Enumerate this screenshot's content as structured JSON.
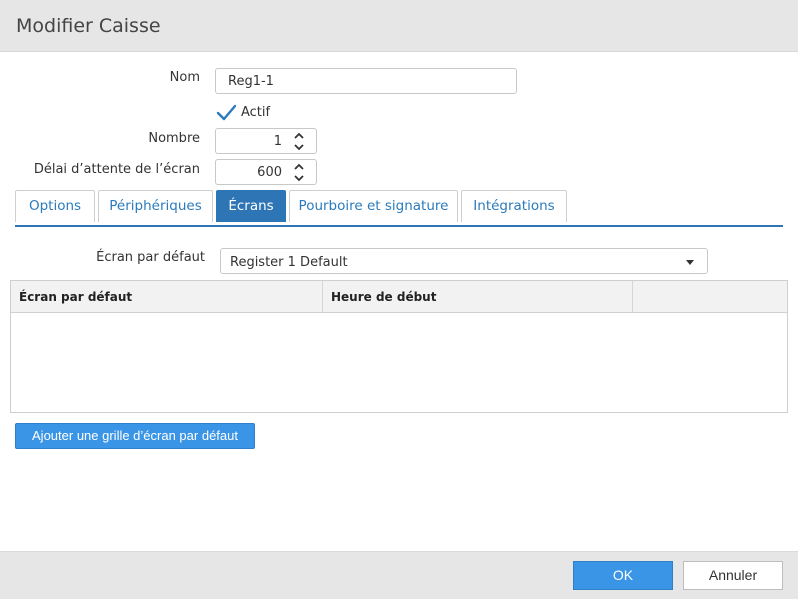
{
  "dialog": {
    "title": "Modifier Caisse"
  },
  "form": {
    "name_label": "Nom",
    "name_value": "Reg1-1",
    "active_label": "Actif",
    "active_checked": true,
    "number_label": "Nombre",
    "number_value": "1",
    "timeout_label": "Délai d’attente de l’écran",
    "timeout_value": "600"
  },
  "tabs": [
    {
      "label": "Options"
    },
    {
      "label": "Périphériques"
    },
    {
      "label": "Écrans",
      "active": true
    },
    {
      "label": "Pourboire et signature"
    },
    {
      "label": "Intégrations"
    }
  ],
  "screens": {
    "default_label": "Écran par défaut",
    "default_value": "Register 1 Default",
    "grid_columns": [
      "Écran par défaut",
      "Heure de début",
      ""
    ],
    "grid_rows": [],
    "add_button": "Ajouter une grille d’écran par défaut"
  },
  "footer": {
    "ok_label": "OK",
    "cancel_label": "Annuler"
  },
  "colors": {
    "accent": "#2e75b6",
    "button_blue": "#3a95e6",
    "chrome": "#e6e6e6"
  }
}
